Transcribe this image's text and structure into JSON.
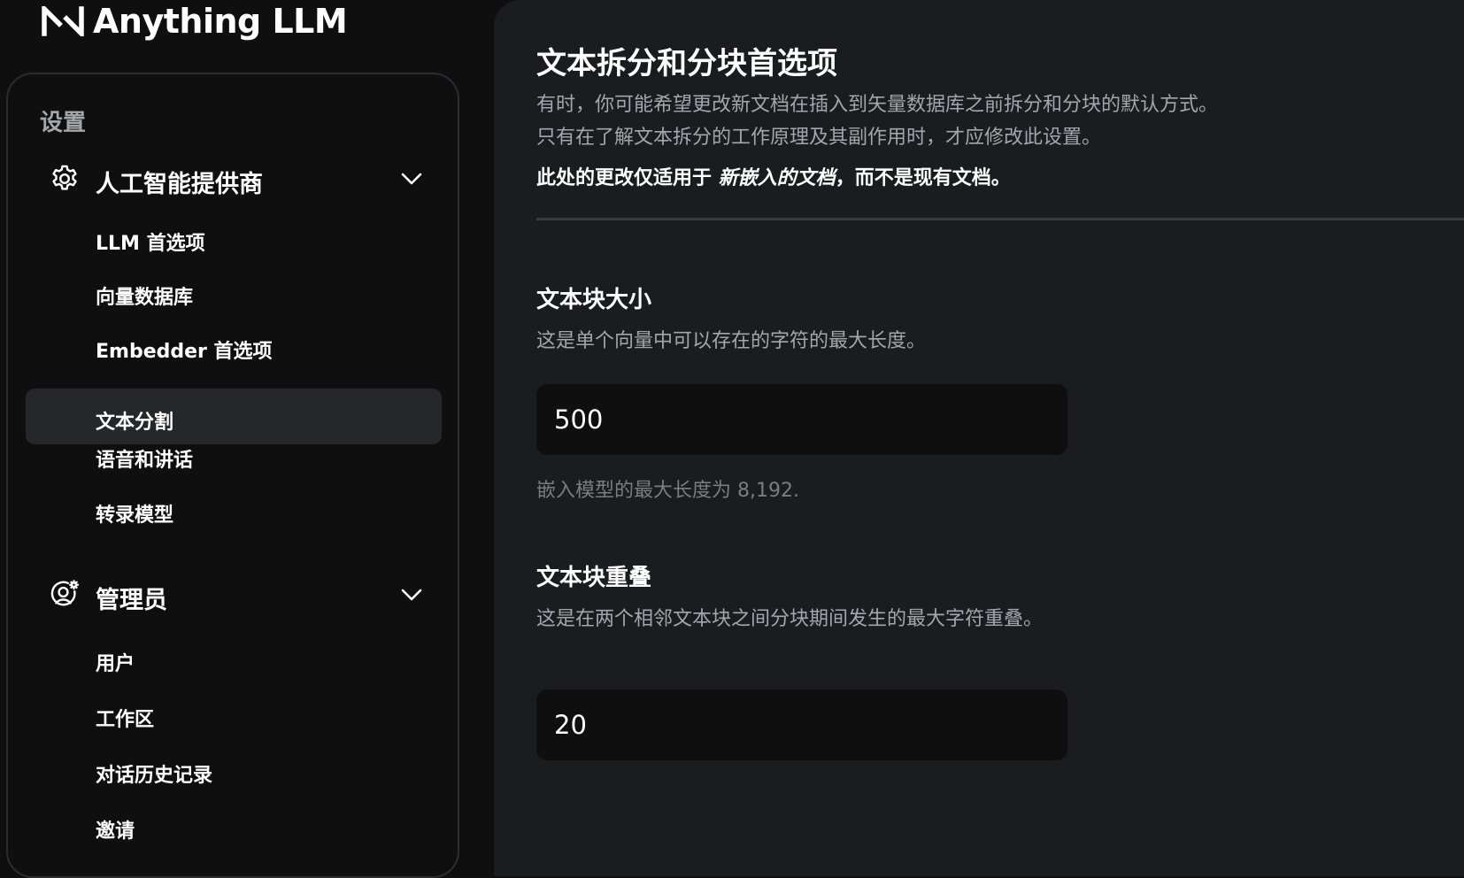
{
  "app": {
    "name": "Anything LLM"
  },
  "sidebar": {
    "heading": "设置",
    "groups": [
      {
        "label": "人工智能提供商",
        "icon": "gear-icon",
        "expanded": true,
        "items": [
          {
            "label": "LLM 首选项",
            "active": false
          },
          {
            "label": "向量数据库",
            "active": false
          },
          {
            "label": "Embedder 首选项",
            "active": false
          },
          {
            "label": "文本分割",
            "active": true
          },
          {
            "label": "语音和讲话",
            "active": false
          },
          {
            "label": "转录模型",
            "active": false
          }
        ]
      },
      {
        "label": "管理员",
        "icon": "user-gear-icon",
        "expanded": true,
        "items": [
          {
            "label": "用户",
            "active": false
          },
          {
            "label": "工作区",
            "active": false
          },
          {
            "label": "对话历史记录",
            "active": false
          },
          {
            "label": "邀请",
            "active": false
          }
        ]
      }
    ]
  },
  "main": {
    "title": "文本拆分和分块首选项",
    "description_lines": [
      "有时，你可能希望更改新文档在插入到矢量数据库之前拆分和分块的默认方式。",
      "只有在了解文本拆分的工作原理及其副作用时，才应修改此设置。"
    ],
    "note": {
      "prefix": "此处的更改仅适用于 ",
      "emphasis": "新嵌入的文档",
      "suffix": "，而不是现有文档。"
    },
    "chunk_size": {
      "label": "文本块大小",
      "description": "这是单个向量中可以存在的字符的最大长度。",
      "value": "500",
      "hint": "嵌入模型的最大长度为 8,192."
    },
    "chunk_overlap": {
      "label": "文本块重叠",
      "description": "这是在两个相邻文本块之间分块期间发生的最大字符重叠。",
      "value": "20"
    }
  },
  "colors": {
    "page_background": "#0f0f10",
    "panel_background": "#1b1c1f",
    "active_item": "#26272a",
    "muted_text": "#a4a6ab",
    "hint_text": "#7a7c80"
  }
}
